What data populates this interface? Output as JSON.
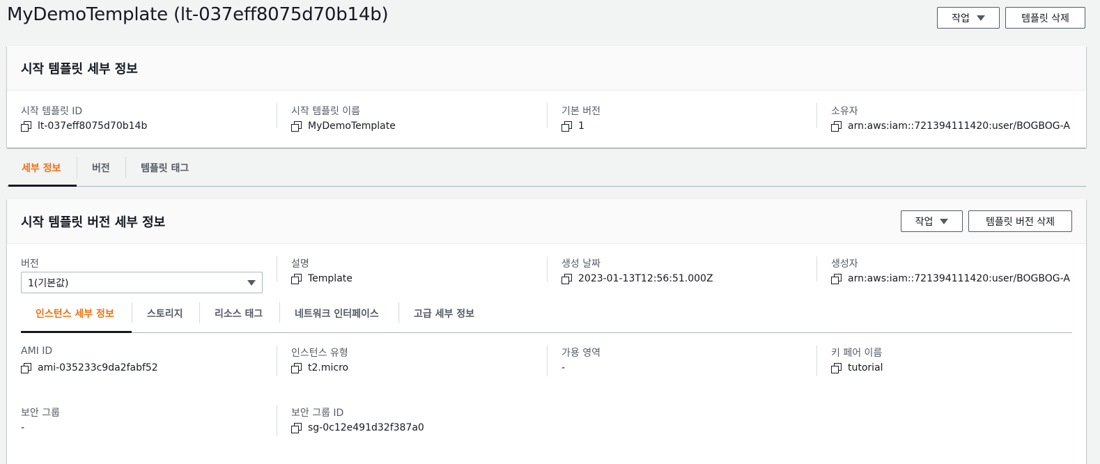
{
  "header": {
    "title": "MyDemoTemplate (lt-037eff8075d70b14b)",
    "actions_label": "작업",
    "delete_label": "템플릿 삭제"
  },
  "template_details": {
    "title": "시작 템플릿 세부 정보",
    "fields": [
      {
        "label": "시작 템플릿 ID",
        "value": "lt-037eff8075d70b14b"
      },
      {
        "label": "시작 템플릿 이름",
        "value": "MyDemoTemplate"
      },
      {
        "label": "기본 버전",
        "value": "1"
      },
      {
        "label": "소유자",
        "value": "arn:aws:iam::721394111420:user/BOGBOG-A"
      }
    ]
  },
  "main_tabs": [
    "세부 정보",
    "버전",
    "템플릿 태그"
  ],
  "version_details": {
    "title": "시작 템플릿 버전 세부 정보",
    "actions_label": "작업",
    "delete_label": "템플릿 버전 삭제",
    "version_label": "버전",
    "version_selected": "1(기본값)",
    "fields": [
      {
        "label": "설명",
        "value": "Template"
      },
      {
        "label": "생성 날짜",
        "value": "2023-01-13T12:56:51.000Z"
      },
      {
        "label": "생성자",
        "value": "arn:aws:iam::721394111420:user/BOGBOG-A"
      }
    ]
  },
  "sub_tabs": [
    "인스턴스 세부 정보",
    "스토리지",
    "리소스 태그",
    "네트워크 인터페이스",
    "고급 세부 정보"
  ],
  "instance_details": [
    {
      "label": "AMI ID",
      "value": "ami-035233c9da2fabf52"
    },
    {
      "label": "인스턴스 유형",
      "value": "t2.micro"
    },
    {
      "label": "가용 영역",
      "value": "-"
    },
    {
      "label": "키 페어 이름",
      "value": "tutorial"
    },
    {
      "label": "보안 그룹",
      "value": "-"
    },
    {
      "label": "보안 그룹 ID",
      "value": "sg-0c12e491d32f387a0"
    }
  ],
  "colors": {
    "accent": "#ec7211",
    "background": "#f2f3f3",
    "text": "#16191f"
  }
}
